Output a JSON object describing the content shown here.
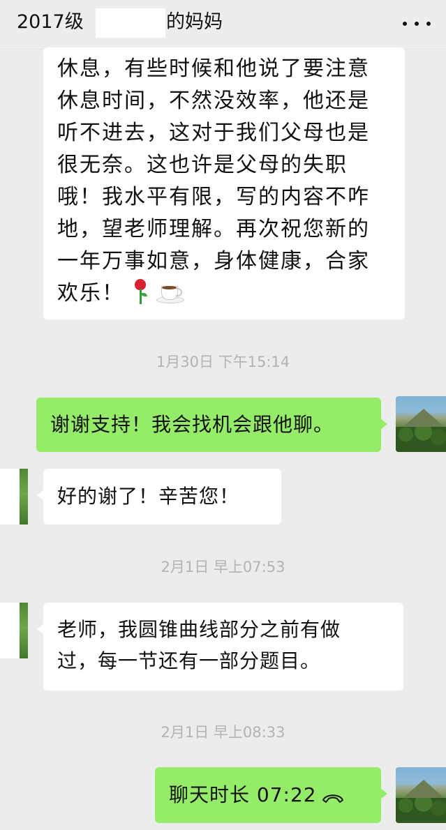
{
  "header": {
    "title_prefix": "2017级",
    "title_suffix": "的妈妈",
    "more_icon": "more-dots-icon"
  },
  "messages": [
    {
      "sender": "contact",
      "lines": [
        "休息，有些时候和他说了要注意",
        "休息时间，不然没效率，他还是",
        "听不进去，这对于我们父母也是",
        "很无奈。这也许是父母的失职",
        "哦！我水平有限，写的内容不咋",
        "地，望老师理解。再次祝您新的",
        "一年万事如意，身体健康，合家",
        "欢乐！"
      ],
      "emojis": [
        "rose-emoji",
        "coffee-emoji"
      ]
    },
    {
      "timestamp": "1月30日 下午15:14"
    },
    {
      "sender": "me",
      "text": "谢谢支持！我会找机会跟他聊。"
    },
    {
      "sender": "contact",
      "text": "好的谢了！辛苦您！"
    },
    {
      "timestamp": "2月1日 早上07:53"
    },
    {
      "sender": "contact",
      "lines": [
        "老师，我圆锥曲线部分之前有做",
        "过，每一节还有一部分题目。"
      ]
    },
    {
      "timestamp": "2月1日 早上08:33"
    },
    {
      "sender": "me",
      "text": "聊天时长 07:22",
      "icon": "hang-up-phone-icon"
    }
  ]
}
